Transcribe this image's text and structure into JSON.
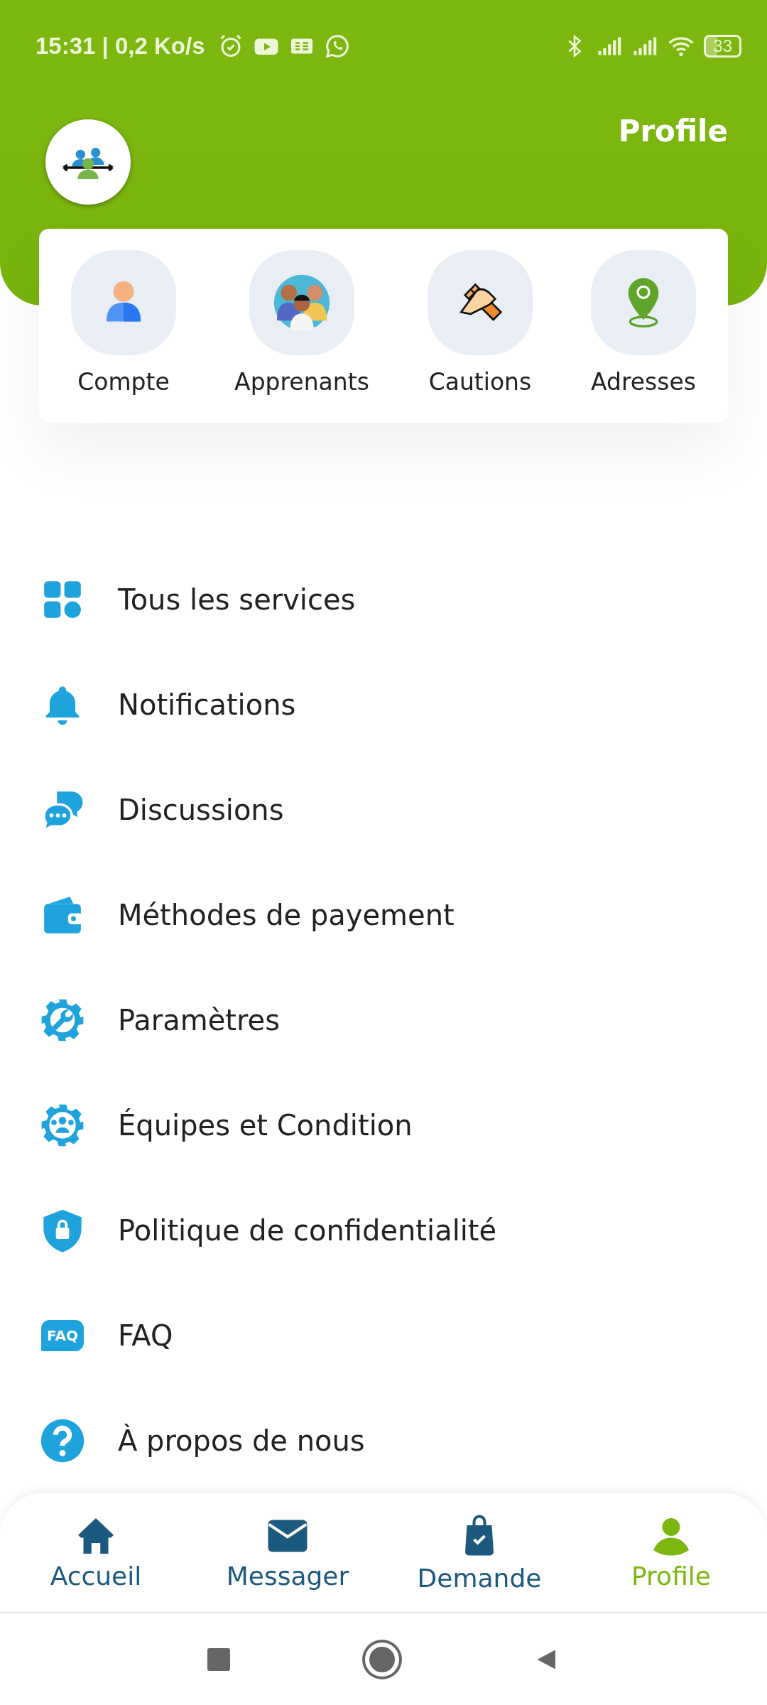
{
  "status_bar": {
    "time_speed": "15:31 | 0,2 Ko/s",
    "battery": "33"
  },
  "header": {
    "title": "Profile"
  },
  "shortcuts": [
    {
      "label": "Compte"
    },
    {
      "label": "Apprenants"
    },
    {
      "label": "Cautions"
    },
    {
      "label": "Adresses"
    }
  ],
  "menu": [
    {
      "label": "Tous les services"
    },
    {
      "label": "Notifications"
    },
    {
      "label": "Discussions"
    },
    {
      "label": "Méthodes de payement"
    },
    {
      "label": "Paramètres"
    },
    {
      "label": "Équipes et Condition"
    },
    {
      "label": "Politique de confidentialité"
    },
    {
      "label": "FAQ",
      "icon_text": "FAQ"
    },
    {
      "label": "À propos de nous"
    }
  ],
  "bottom_nav": [
    {
      "label": "Accueil",
      "selected": false
    },
    {
      "label": "Messager",
      "selected": false
    },
    {
      "label": "Demande",
      "selected": false
    },
    {
      "label": "Profile",
      "selected": true
    }
  ]
}
